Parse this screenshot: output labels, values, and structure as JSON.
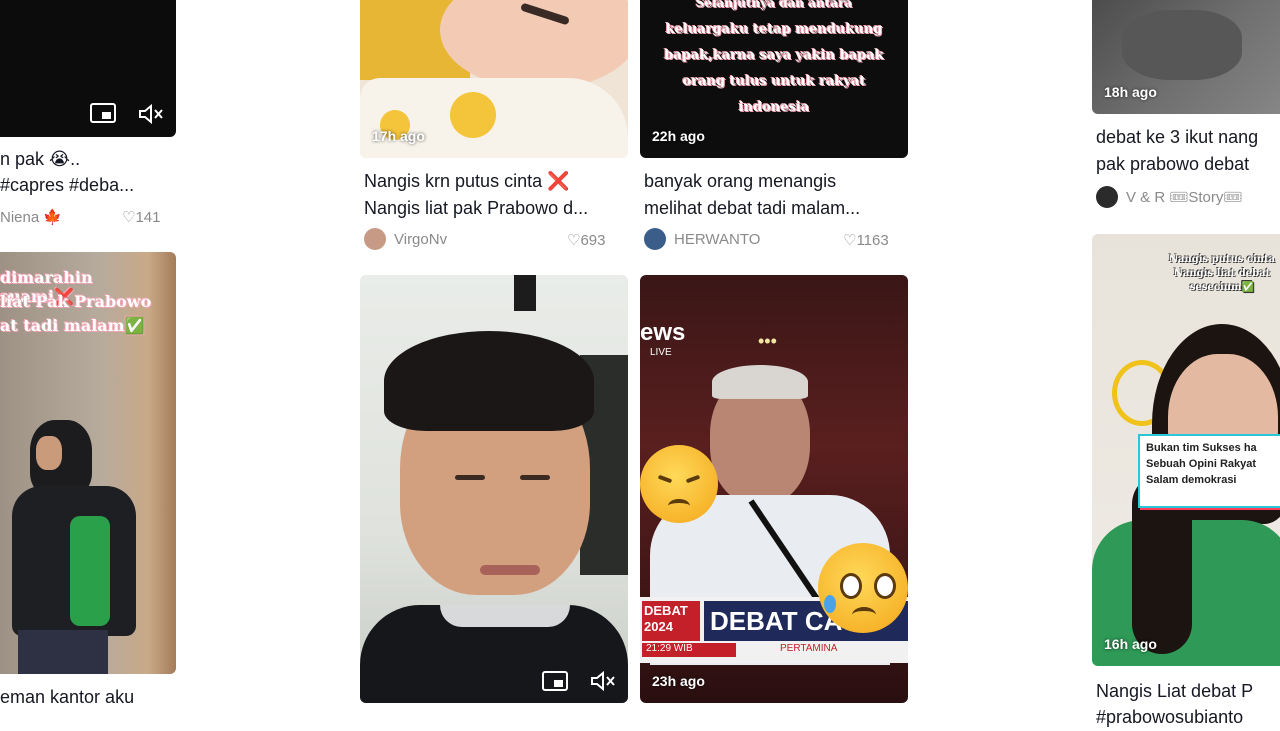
{
  "col1": {
    "card1": {
      "caption_line1": "n pak 😭..",
      "caption_line2": "#capres #deba...",
      "author": "Niena 🍁",
      "likes": "♡141"
    },
    "card2": {
      "overlay_line1": "dimarahin suami❌",
      "overlay_line2": "liat Pak Prabowo",
      "overlay_line3": "at tadi malam✅",
      "caption_line1": "eman kantor aku"
    }
  },
  "col2": {
    "card1": {
      "time": "17h ago",
      "caption_line1": "Nangis krn putus cinta ❌",
      "caption_line2": "Nangis liat pak Prabowo d...",
      "author": "VirgoNv",
      "likes": "♡693"
    },
    "card2": {}
  },
  "col3": {
    "card1": {
      "time": "22h ago",
      "overlay_line1": "Selanjutnya dan antara",
      "overlay_line2": "keluargaku tetap mendukung",
      "overlay_line3": "bapak,karna saya yakin bapak",
      "overlay_line4": "orang tulus untuk rakyat",
      "overlay_line5": "indonesia",
      "caption_line1": "banyak orang menangis",
      "caption_line2": "melihat debat tadi malam...",
      "author": "HERWANTO",
      "likes": "♡1163"
    },
    "card2": {
      "time": "23h ago",
      "news_logo": "ews",
      "news_live": "LIVE",
      "banner_year": "DEBAT 2024",
      "banner_text": "DEBAT CA",
      "banner_clock": "21:29 WIB",
      "banner_sponsor": "PERTAMINA"
    }
  },
  "col4": {
    "card1": {
      "time": "18h ago",
      "caption_line1": "debat ke 3 ikut nang",
      "caption_line2": "pak prabowo debat",
      "author": "V & R 🎟Story🎟"
    },
    "card2": {
      "time": "16h ago",
      "overlay_top1": "Nangis putus cinta",
      "overlay_top2": "Nangis liat debat",
      "overlay_top3": "sesecium✅",
      "box_line1": "Bukan tim Sukses ha",
      "box_line2": "Sebuah Opini Rakyat",
      "box_line3": "Salam demokrasi",
      "caption_line1": "Nangis Liat debat P",
      "caption_line2": "#prabowosubianto"
    }
  },
  "colors": {
    "caption": "#161823",
    "meta_gray": "#8a8a8a",
    "dark_thumb": "#0d0d0d"
  }
}
